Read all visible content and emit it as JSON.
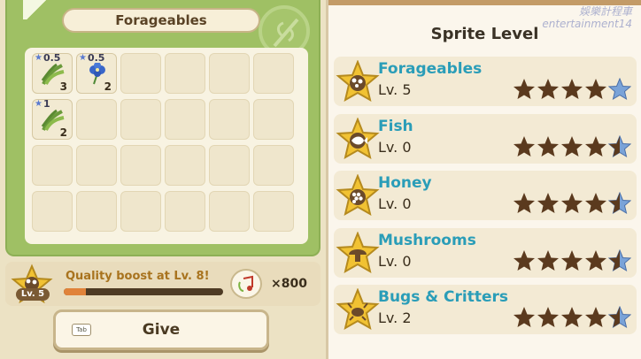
{
  "inventory": {
    "title": "Forageables",
    "slots": [
      {
        "item": "grass-bundle",
        "rate": "0.5",
        "qty": "3"
      },
      {
        "item": "blue-flower",
        "rate": "0.5",
        "qty": "2"
      },
      {
        "item": "",
        "rate": "",
        "qty": ""
      },
      {
        "item": "",
        "rate": "",
        "qty": ""
      },
      {
        "item": "",
        "rate": "",
        "qty": ""
      },
      {
        "item": "",
        "rate": "",
        "qty": ""
      },
      {
        "item": "grass-bundle",
        "rate": "1",
        "qty": "2"
      },
      {
        "item": "",
        "rate": "",
        "qty": ""
      },
      {
        "item": "",
        "rate": "",
        "qty": ""
      },
      {
        "item": "",
        "rate": "",
        "qty": ""
      },
      {
        "item": "",
        "rate": "",
        "qty": ""
      },
      {
        "item": "",
        "rate": "",
        "qty": ""
      },
      {
        "item": "",
        "rate": "",
        "qty": ""
      },
      {
        "item": "",
        "rate": "",
        "qty": ""
      },
      {
        "item": "",
        "rate": "",
        "qty": ""
      },
      {
        "item": "",
        "rate": "",
        "qty": ""
      },
      {
        "item": "",
        "rate": "",
        "qty": ""
      },
      {
        "item": "",
        "rate": "",
        "qty": ""
      },
      {
        "item": "",
        "rate": "",
        "qty": ""
      },
      {
        "item": "",
        "rate": "",
        "qty": ""
      },
      {
        "item": "",
        "rate": "",
        "qty": ""
      },
      {
        "item": "",
        "rate": "",
        "qty": ""
      },
      {
        "item": "",
        "rate": "",
        "qty": ""
      },
      {
        "item": "",
        "rate": "",
        "qty": ""
      }
    ]
  },
  "quality": {
    "badge_label": "Lv. 5",
    "text": "Quality boost at Lv. 8!",
    "progress": 0.14,
    "cost": "×800"
  },
  "give_button": {
    "key_hint": "Tab",
    "label": "Give"
  },
  "watermark": {
    "line1": "娛樂計程車",
    "line2": "entertainment14"
  },
  "sprite_level": {
    "title": "Sprite Level",
    "rows": [
      {
        "name": "Forageables",
        "level": "Lv. 5",
        "icon": "mushroom-basket-icon",
        "filled_stars": 4,
        "last_star": "blue"
      },
      {
        "name": "Fish",
        "level": "Lv. 0",
        "icon": "fish-icon",
        "filled_stars": 4,
        "last_star": "half"
      },
      {
        "name": "Honey",
        "level": "Lv. 0",
        "icon": "honeycomb-icon",
        "filled_stars": 4,
        "last_star": "half"
      },
      {
        "name": "Mushrooms",
        "level": "Lv. 0",
        "icon": "mushroom-icon",
        "filled_stars": 4,
        "last_star": "half"
      },
      {
        "name": "Bugs & Critters",
        "level": "Lv. 2",
        "icon": "bug-icon",
        "filled_stars": 4,
        "last_star": "half"
      }
    ]
  },
  "colors": {
    "accent_teal": "#2a9db8",
    "star_dark": "#5b3a1e",
    "star_blue": "#7aa3d8",
    "panel_green": "#9fc064"
  }
}
